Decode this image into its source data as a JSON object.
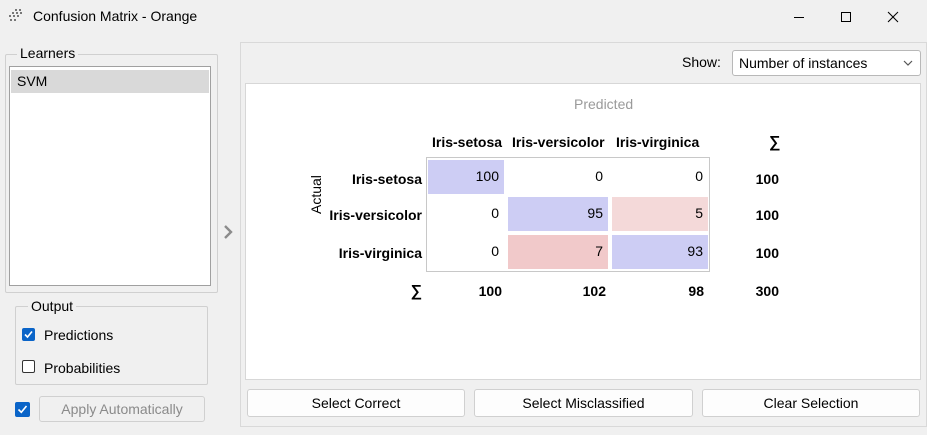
{
  "window": {
    "title": "Confusion Matrix - Orange"
  },
  "learners": {
    "label": "Learners",
    "items": [
      "SVM"
    ]
  },
  "output": {
    "label": "Output",
    "predictions": {
      "label": "Predictions",
      "checked": true
    },
    "probabilities": {
      "label": "Probabilities",
      "checked": false
    }
  },
  "apply": {
    "label": "Apply Automatically",
    "checked": true
  },
  "show": {
    "label": "Show:",
    "value": "Number of instances"
  },
  "matrix": {
    "predicted_label": "Predicted",
    "actual_label": "Actual",
    "sum_symbol": "∑",
    "classes": [
      "Iris-setosa",
      "Iris-versicolor",
      "Iris-virginica"
    ],
    "rows": [
      {
        "values": [
          "100",
          "0",
          "0"
        ],
        "total": "100"
      },
      {
        "values": [
          "0",
          "95",
          "5"
        ],
        "total": "100"
      },
      {
        "values": [
          "0",
          "7",
          "93"
        ],
        "total": "100"
      }
    ],
    "column_totals": [
      "100",
      "102",
      "98"
    ],
    "grand_total": "300",
    "colors": {
      "correct": "#cdcdf4",
      "error_light": "#f4d9d9",
      "error_dark": "#f1c9ca"
    }
  },
  "buttons": {
    "select_correct": "Select Correct",
    "select_misclassified": "Select Misclassified",
    "clear_selection": "Clear Selection"
  }
}
